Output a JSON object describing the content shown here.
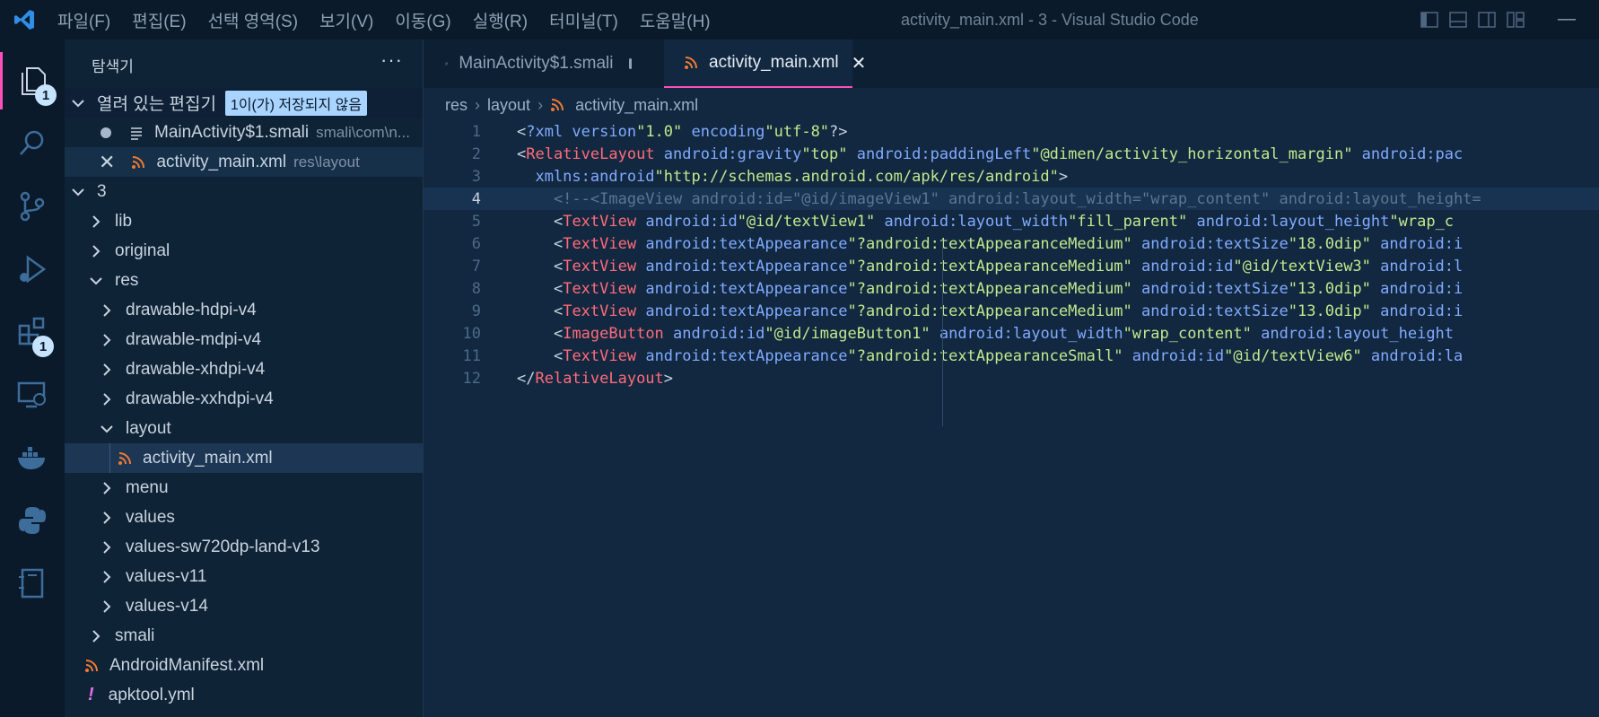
{
  "window": {
    "title": "activity_main.xml - 3 - Visual Studio Code",
    "menu": [
      "파일(F)",
      "편집(E)",
      "선택 영역(S)",
      "보기(V)",
      "이동(G)",
      "실행(R)",
      "터미널(T)",
      "도움말(H)"
    ]
  },
  "activity_bar": {
    "explorer_badge": "1",
    "extensions_badge": "1"
  },
  "sidebar": {
    "title": "탐색기",
    "more": "···",
    "open_editors_label": "열려 있는 편집기",
    "unsaved_badge": "1이(가) 저장되지 않음",
    "open_editors": [
      {
        "name": "MainActivity$1.smali",
        "path": "smali\\com\\n..."
      },
      {
        "name": "activity_main.xml",
        "path": "res\\layout"
      }
    ],
    "root": "3",
    "tree": [
      "lib",
      "original",
      "res",
      "drawable-hdpi-v4",
      "drawable-mdpi-v4",
      "drawable-xhdpi-v4",
      "drawable-xxhdpi-v4",
      "layout",
      "activity_main.xml",
      "menu",
      "values",
      "values-sw720dp-land-v13",
      "values-v11",
      "values-v14",
      "smali",
      "AndroidManifest.xml",
      "apktool.yml"
    ]
  },
  "editor": {
    "tabs": [
      {
        "label": "MainActivity$1.smali"
      },
      {
        "label": "activity_main.xml"
      }
    ],
    "breadcrumb": [
      "res",
      "layout",
      "activity_main.xml"
    ],
    "line_numbers": [
      "1",
      "2",
      "3",
      "4",
      "5",
      "6",
      "7",
      "8",
      "9",
      "10",
      "11",
      "12"
    ],
    "lines": [
      "<?xml version=\"1.0\" encoding=\"utf-8\"?>",
      "<RelativeLayout android:gravity=\"top\" android:paddingLeft=\"@dimen/activity_horizontal_margin\" android:pac",
      "  xmlns:android=\"http://schemas.android.com/apk/res/android\">",
      "    <!--<ImageView android:id=\"@id/imageView1\" android:layout_width=\"wrap_content\" android:layout_height=",
      "    <TextView android:id=\"@id/textView1\" android:layout_width=\"fill_parent\" android:layout_height=\"wrap_c",
      "    <TextView android:textAppearance=\"?android:textAppearanceMedium\" android:textSize=\"18.0dip\" android:i",
      "    <TextView android:textAppearance=\"?android:textAppearanceMedium\" android:id=\"@id/textView3\" android:l",
      "    <TextView android:textAppearance=\"?android:textAppearanceMedium\" android:textSize=\"13.0dip\" android:i",
      "    <TextView android:textAppearance=\"?android:textAppearanceMedium\" android:textSize=\"13.0dip\" android:i",
      "    <ImageButton android:id=\"@id/imageButton1\" android:layout_width=\"wrap_content\" android:layout_height=",
      "    <TextView android:textAppearance=\"?android:textAppearanceSmall\" android:id=\"@id/textView6\" android:la",
      "</RelativeLayout>"
    ]
  },
  "colors": {
    "accent": "#ff4fb8",
    "tag": "#ff6b7a",
    "attr": "#82aaff",
    "string": "#c3e88d",
    "comment": "#5c7590",
    "xml_icon": "#f07a32"
  }
}
